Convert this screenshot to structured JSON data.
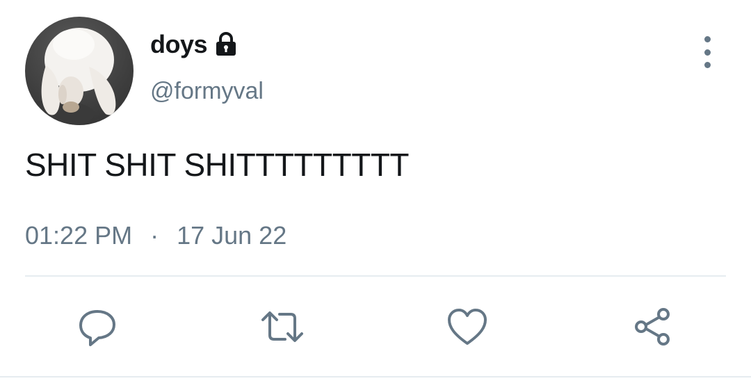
{
  "user": {
    "display_name": "doys",
    "handle": "@formyval",
    "protected_icon": "lock-icon",
    "avatar_icon": "white-rabbit-avatar"
  },
  "tweet": {
    "text": "SHIT SHIT SHITTTTTTTTT",
    "time": "01:22 PM",
    "separator": "·",
    "date": "17 Jun 22"
  },
  "actions": [
    {
      "name": "reply",
      "icon": "comment-icon"
    },
    {
      "name": "retweet",
      "icon": "retweet-icon"
    },
    {
      "name": "like",
      "icon": "heart-icon"
    },
    {
      "name": "share",
      "icon": "share-icon"
    }
  ],
  "colors": {
    "text": "#14171a",
    "secondary": "#657786",
    "divider": "#e6ecf0"
  }
}
